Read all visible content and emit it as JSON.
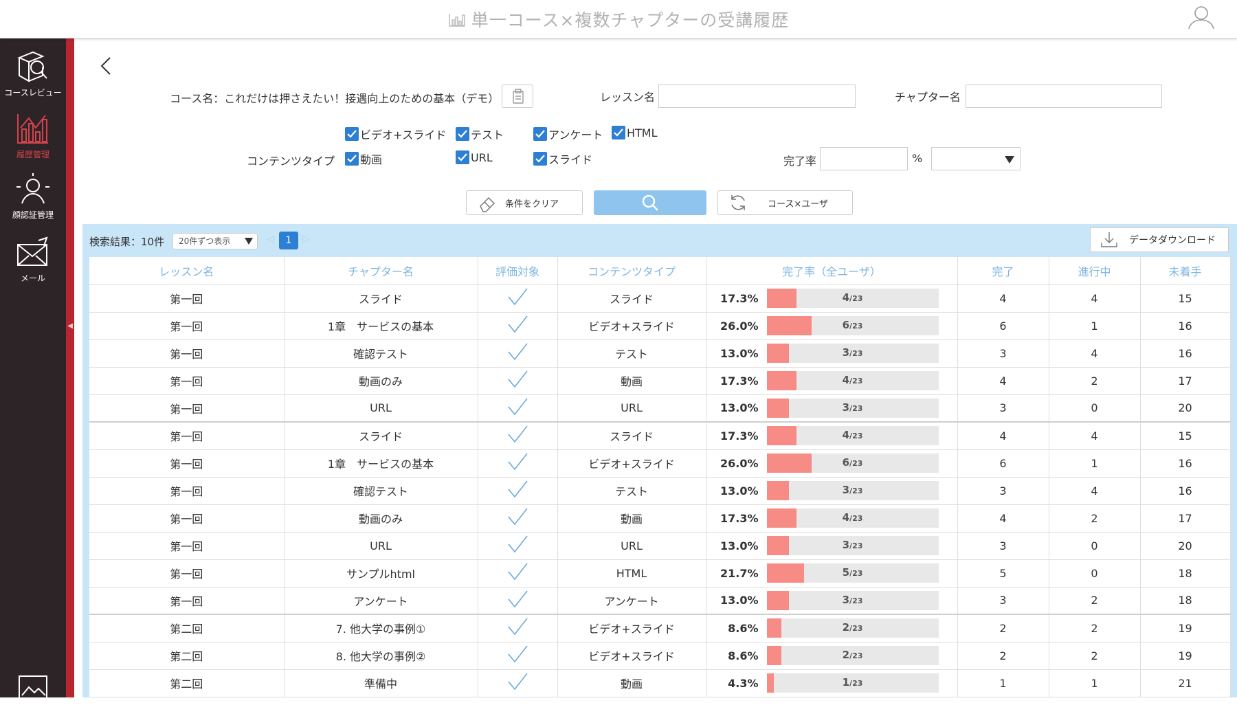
{
  "header": {
    "title": "単一コース×複数チャプターの受講履歴"
  },
  "sidebar": {
    "items": [
      {
        "label": "コースレビュー"
      },
      {
        "label": "履歴管理"
      },
      {
        "label": "顔認証管理"
      },
      {
        "label": "メール"
      }
    ]
  },
  "filters": {
    "course_label": "コース名：これだけは押さえたい！接遇向上のための基本（デモ）",
    "lesson_label": "レッスン名",
    "lesson_value": "",
    "chapter_label": "チャプター名",
    "chapter_value": "",
    "content_type_label": "コンテンツタイプ",
    "content_types": [
      "ビデオ+スライド",
      "テスト",
      "アンケート",
      "HTML",
      "動画",
      "URL",
      "スライド"
    ],
    "completion_label": "完了率",
    "completion_value": "",
    "percent_unit": "%",
    "completion_operator": ""
  },
  "buttons": {
    "clear": "条件をクリア",
    "course_user": "コース×ユーザ",
    "download": "データダウンロード"
  },
  "results": {
    "count_text": "検索結果：10件",
    "per_page": "20件ずつ表示",
    "current_page": "1"
  },
  "table": {
    "headers": [
      "レッスン名",
      "チャプター名",
      "評価対象",
      "コンテンツタイプ",
      "完了率（全ユーザ）",
      "完了",
      "進行中",
      "未着手"
    ],
    "total_users": 23,
    "rows": [
      {
        "lesson": "第一回",
        "chapter": "スライド",
        "type": "スライド",
        "rate": "17.3%",
        "done": "4",
        "progress": "4",
        "notstarted": "15",
        "frac": "4",
        "group_start": false
      },
      {
        "lesson": "第一回",
        "chapter": "1章　サービスの基本",
        "type": "ビデオ+スライド",
        "rate": "26.0%",
        "done": "6",
        "progress": "1",
        "notstarted": "16",
        "frac": "6",
        "group_start": false
      },
      {
        "lesson": "第一回",
        "chapter": "確認テスト",
        "type": "テスト",
        "rate": "13.0%",
        "done": "3",
        "progress": "4",
        "notstarted": "16",
        "frac": "3",
        "group_start": false
      },
      {
        "lesson": "第一回",
        "chapter": "動画のみ",
        "type": "動画",
        "rate": "17.3%",
        "done": "4",
        "progress": "2",
        "notstarted": "17",
        "frac": "4",
        "group_start": false
      },
      {
        "lesson": "第一回",
        "chapter": "URL",
        "type": "URL",
        "rate": "13.0%",
        "done": "3",
        "progress": "0",
        "notstarted": "20",
        "frac": "3",
        "group_start": false
      },
      {
        "lesson": "第一回",
        "chapter": "スライド",
        "type": "スライド",
        "rate": "17.3%",
        "done": "4",
        "progress": "4",
        "notstarted": "15",
        "frac": "4",
        "group_start": true
      },
      {
        "lesson": "第一回",
        "chapter": "1章　サービスの基本",
        "type": "ビデオ+スライド",
        "rate": "26.0%",
        "done": "6",
        "progress": "1",
        "notstarted": "16",
        "frac": "6",
        "group_start": false
      },
      {
        "lesson": "第一回",
        "chapter": "確認テスト",
        "type": "テスト",
        "rate": "13.0%",
        "done": "3",
        "progress": "4",
        "notstarted": "16",
        "frac": "3",
        "group_start": false
      },
      {
        "lesson": "第一回",
        "chapter": "動画のみ",
        "type": "動画",
        "rate": "17.3%",
        "done": "4",
        "progress": "2",
        "notstarted": "17",
        "frac": "4",
        "group_start": false
      },
      {
        "lesson": "第一回",
        "chapter": "URL",
        "type": "URL",
        "rate": "13.0%",
        "done": "3",
        "progress": "0",
        "notstarted": "20",
        "frac": "3",
        "group_start": false
      },
      {
        "lesson": "第一回",
        "chapter": "サンプルhtml",
        "type": "HTML",
        "rate": "21.7%",
        "done": "5",
        "progress": "0",
        "notstarted": "18",
        "frac": "5",
        "group_start": false
      },
      {
        "lesson": "第一回",
        "chapter": "アンケート",
        "type": "アンケート",
        "rate": "13.0%",
        "done": "3",
        "progress": "2",
        "notstarted": "18",
        "frac": "3",
        "group_start": false
      },
      {
        "lesson": "第二回",
        "chapter": "7. 他大学の事例①",
        "type": "ビデオ+スライド",
        "rate": "8.6%",
        "done": "2",
        "progress": "2",
        "notstarted": "19",
        "frac": "2",
        "group_start": true
      },
      {
        "lesson": "第二回",
        "chapter": "8. 他大学の事例②",
        "type": "ビデオ+スライド",
        "rate": "8.6%",
        "done": "2",
        "progress": "2",
        "notstarted": "19",
        "frac": "2",
        "group_start": false
      },
      {
        "lesson": "第二回",
        "chapter": "準備中",
        "type": "動画",
        "rate": "4.3%",
        "done": "1",
        "progress": "1",
        "notstarted": "21",
        "frac": "1",
        "group_start": false
      }
    ]
  },
  "colors": {
    "accent": "#2d7fd3",
    "sidebar": "#2d2427",
    "sidebar_strip": "#b8242f",
    "bar_fill": "#f78b85",
    "result_bg": "#c9e6f8"
  }
}
